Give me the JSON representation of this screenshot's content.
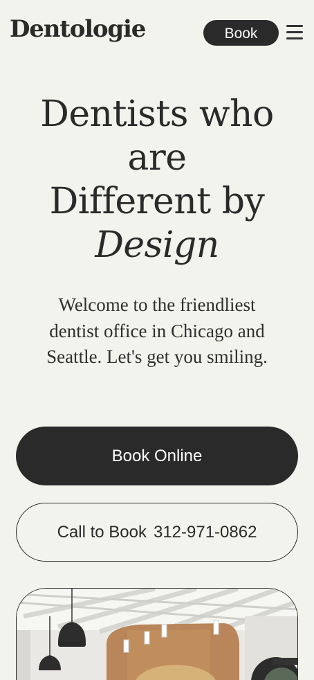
{
  "header": {
    "logo": "Dentologie",
    "book_label": "Book",
    "menu_icon": "hamburger-menu-icon"
  },
  "hero": {
    "title_line_1": "Dentists who",
    "title_line_2": "are",
    "title_line_3": "Different by",
    "title_italic": "Design",
    "subtitle": "Welcome to the friendliest dentist office in Chicago and Seattle. Let's get you smiling."
  },
  "cta": {
    "book_online_label": "Book Online",
    "call_label": "Call to Book",
    "phone": "312-971-0862"
  },
  "colors": {
    "background": "#f2f3ec",
    "primary": "#2a2a2a",
    "on_primary": "#ffffff"
  }
}
